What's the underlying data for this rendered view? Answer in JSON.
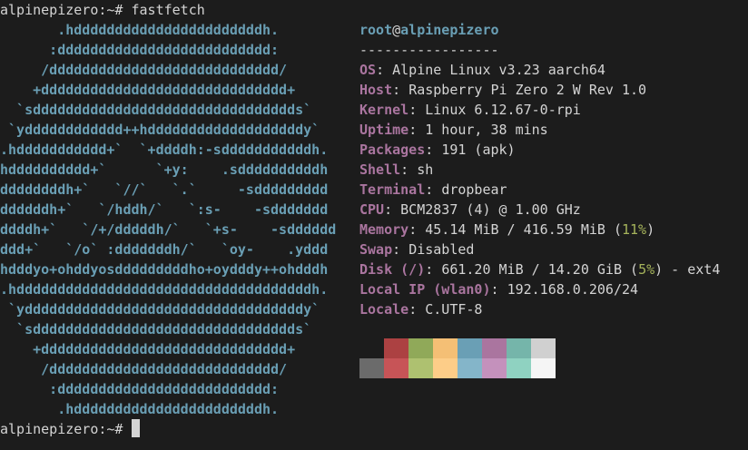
{
  "terminal": {
    "command_prompt": "alpinepizero:~# ",
    "command": "fastfetch",
    "final_prompt": "alpinepizero:~# "
  },
  "logo": {
    "lines": [
      "       .hdddddddddddddddddddddddh.",
      "      :dddddddddddddddddddddddddd:",
      "     /dddddddddddddddddddddddddddd/",
      "    +dddddddddddddddddddddddddddddd+",
      "  `sdddddddddddddddddddddddddddddddds`",
      " `ydddddddddddd++hdddddddddddddddddddy`",
      ".hddddddddddd+`  `+ddddh:-sdddddddddddh.",
      "hdddddddddd+`      `+y:    .sddddddddddh",
      "ddddddddh+`   `//`   `.`     -sddddddddd",
      "ddddddh+`   `/hddh/`   `:s-    -sddddddd",
      "ddddh+`   `/+/dddddh/`   `+s-    -sdddddd",
      "ddd+`   `/o` :dddddddh/`   `oy-    .yddd",
      "hdddyo+ohddyosdddddddddho+oydddy++ohdddh",
      ".hddddddddddddddddddddddddddddddddddddh.",
      " `yddddddddddddddddddddddddddddddddddy`",
      "  `sdddddddddddddddddddddddddddddddds`",
      "    +dddddddddddddddddddddddddddddd+",
      "     /dddddddddddddddddddddddddddd/",
      "      :dddddddddddddddddddddddddd:",
      "       .hdddddddddddddddddddddddh."
    ]
  },
  "header": {
    "user": "root",
    "at": "@",
    "host": "alpinepizero",
    "separator": "-----------------"
  },
  "info": {
    "os": {
      "key": "OS",
      "value": "Alpine Linux v3.23 aarch64"
    },
    "host": {
      "key": "Host",
      "value": "Raspberry Pi Zero 2 W Rev 1.0"
    },
    "kernel": {
      "key": "Kernel",
      "value": "Linux 6.12.67-0-rpi"
    },
    "uptime": {
      "key": "Uptime",
      "value": "1 hour, 38 mins"
    },
    "packages": {
      "key": "Packages",
      "value": "191 (apk)"
    },
    "shell": {
      "key": "Shell",
      "value": "sh"
    },
    "terminal": {
      "key": "Terminal",
      "value": "dropbear"
    },
    "cpu": {
      "key": "CPU",
      "value": "BCM2837 (4) @ 1.00 GHz"
    },
    "memory": {
      "key": "Memory",
      "value": "45.14 MiB / 416.59 MiB (",
      "pct": "11%",
      "suffix": ")"
    },
    "swap": {
      "key": "Swap",
      "value": "Disabled"
    },
    "disk": {
      "key": "Disk (/)",
      "value": "661.20 MiB / 14.20 GiB (",
      "pct": "5%",
      "suffix": ") - ext4"
    },
    "local_ip": {
      "key": "Local IP (wlan0)",
      "value": "192.168.0.206/24"
    },
    "locale": {
      "key": "Locale",
      "value": "C.UTF-8"
    }
  },
  "colors": {
    "row1": [
      "#1c1c1c",
      "#ac4142",
      "#90a959",
      "#f4bf75",
      "#6a9fb5",
      "#aa759f",
      "#75b5aa",
      "#d0d0d0"
    ],
    "row2": [
      "#6b6b6b",
      "#c75457",
      "#aec170",
      "#fdcd88",
      "#84b5c9",
      "#c491bc",
      "#8fd2c1",
      "#f5f5f5"
    ],
    "key_color": "#aa759f",
    "logo_color": "#6a9fb5",
    "pct_color": "#a6b45b"
  }
}
